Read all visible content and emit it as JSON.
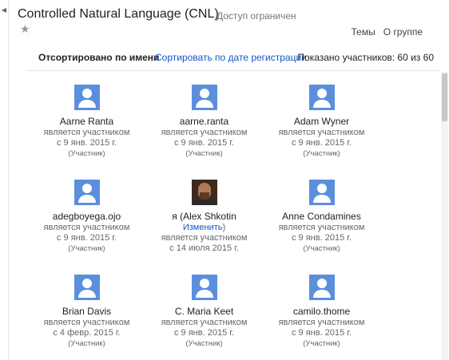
{
  "header": {
    "title": "Controlled Natural Language (CNL)",
    "access": "Доступ ограничен",
    "star_glyph": "★",
    "collapse_glyph": "◀",
    "links": [
      "Темы",
      "О группе"
    ]
  },
  "sortbar": {
    "active": "Отсортировано по имени",
    "by_date": "Сортировать по дате регистрации",
    "shown": "Показано участников: 60 из 60"
  },
  "members": [
    {
      "name": "Aarne Ranta",
      "status": "является участником",
      "date": "с 9 янв. 2015 г.",
      "role": "(Участник)"
    },
    {
      "name": "aarne.ranta",
      "status": "является участником",
      "date": "с 9 янв. 2015 г.",
      "role": "(Участник)"
    },
    {
      "name": "Adam Wyner",
      "status": "является участником",
      "date": "с 9 янв. 2015 г.",
      "role": "(Участник)"
    },
    {
      "name": "adegboyega.ojo",
      "status": "является участником",
      "date": "с 9 янв. 2015 г.",
      "role": "(Участник)"
    },
    {
      "name": "я (Alex Shkotin",
      "change": "Изменить",
      "change_close": ")",
      "status": "является участником",
      "date": "с 14 июля 2015 г.",
      "role": "",
      "photo": true
    },
    {
      "name": "Anne Condamines",
      "status": "является участником",
      "date": "с 9 янв. 2015 г.",
      "role": "(Участник)"
    },
    {
      "name": "Brian Davis",
      "status": "является участником",
      "date": "с 4 февр. 2015 г.",
      "role": "(Участник)"
    },
    {
      "name": "C. Maria Keet",
      "status": "является участником",
      "date": "с 9 янв. 2015 г.",
      "role": "(Участник)"
    },
    {
      "name": "camilo.thome",
      "status": "является участником",
      "date": "с 9 янв. 2015 г.",
      "role": "(Участник)"
    }
  ],
  "colors": {
    "avatar_blue": "#5b8fdc",
    "link_blue": "#1155cc"
  }
}
